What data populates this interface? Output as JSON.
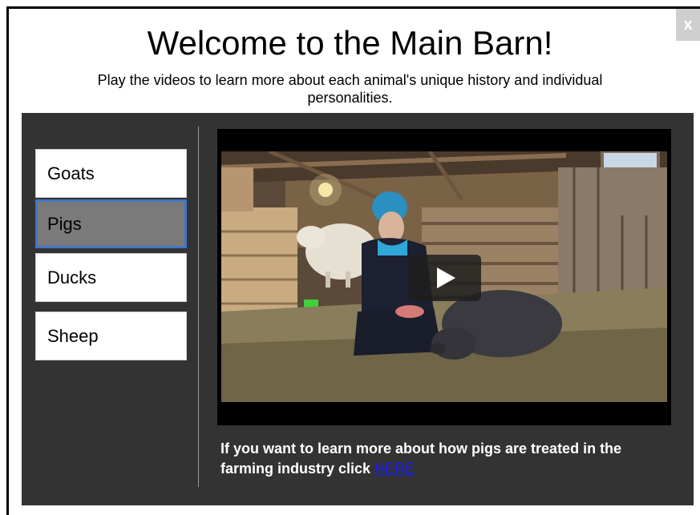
{
  "modal": {
    "close_label": "x",
    "title": "Welcome to the Main Barn!",
    "subtitle": "Play the videos to learn more about each animal's unique history and individual personalities."
  },
  "sidebar": {
    "items": [
      {
        "label": "Goats",
        "active": false
      },
      {
        "label": "Pigs",
        "active": true
      },
      {
        "label": "Ducks",
        "active": false
      },
      {
        "label": "Sheep",
        "active": false
      }
    ]
  },
  "video": {
    "play_icon": "play-icon"
  },
  "info": {
    "text": "If you want to learn more about how pigs are treated in the farming industry click ",
    "link_label": "HERE"
  },
  "colors": {
    "panel": "#333333",
    "active_item": "#7a7a7a",
    "active_border": "#3f76c4",
    "link": "#1a1aff"
  }
}
